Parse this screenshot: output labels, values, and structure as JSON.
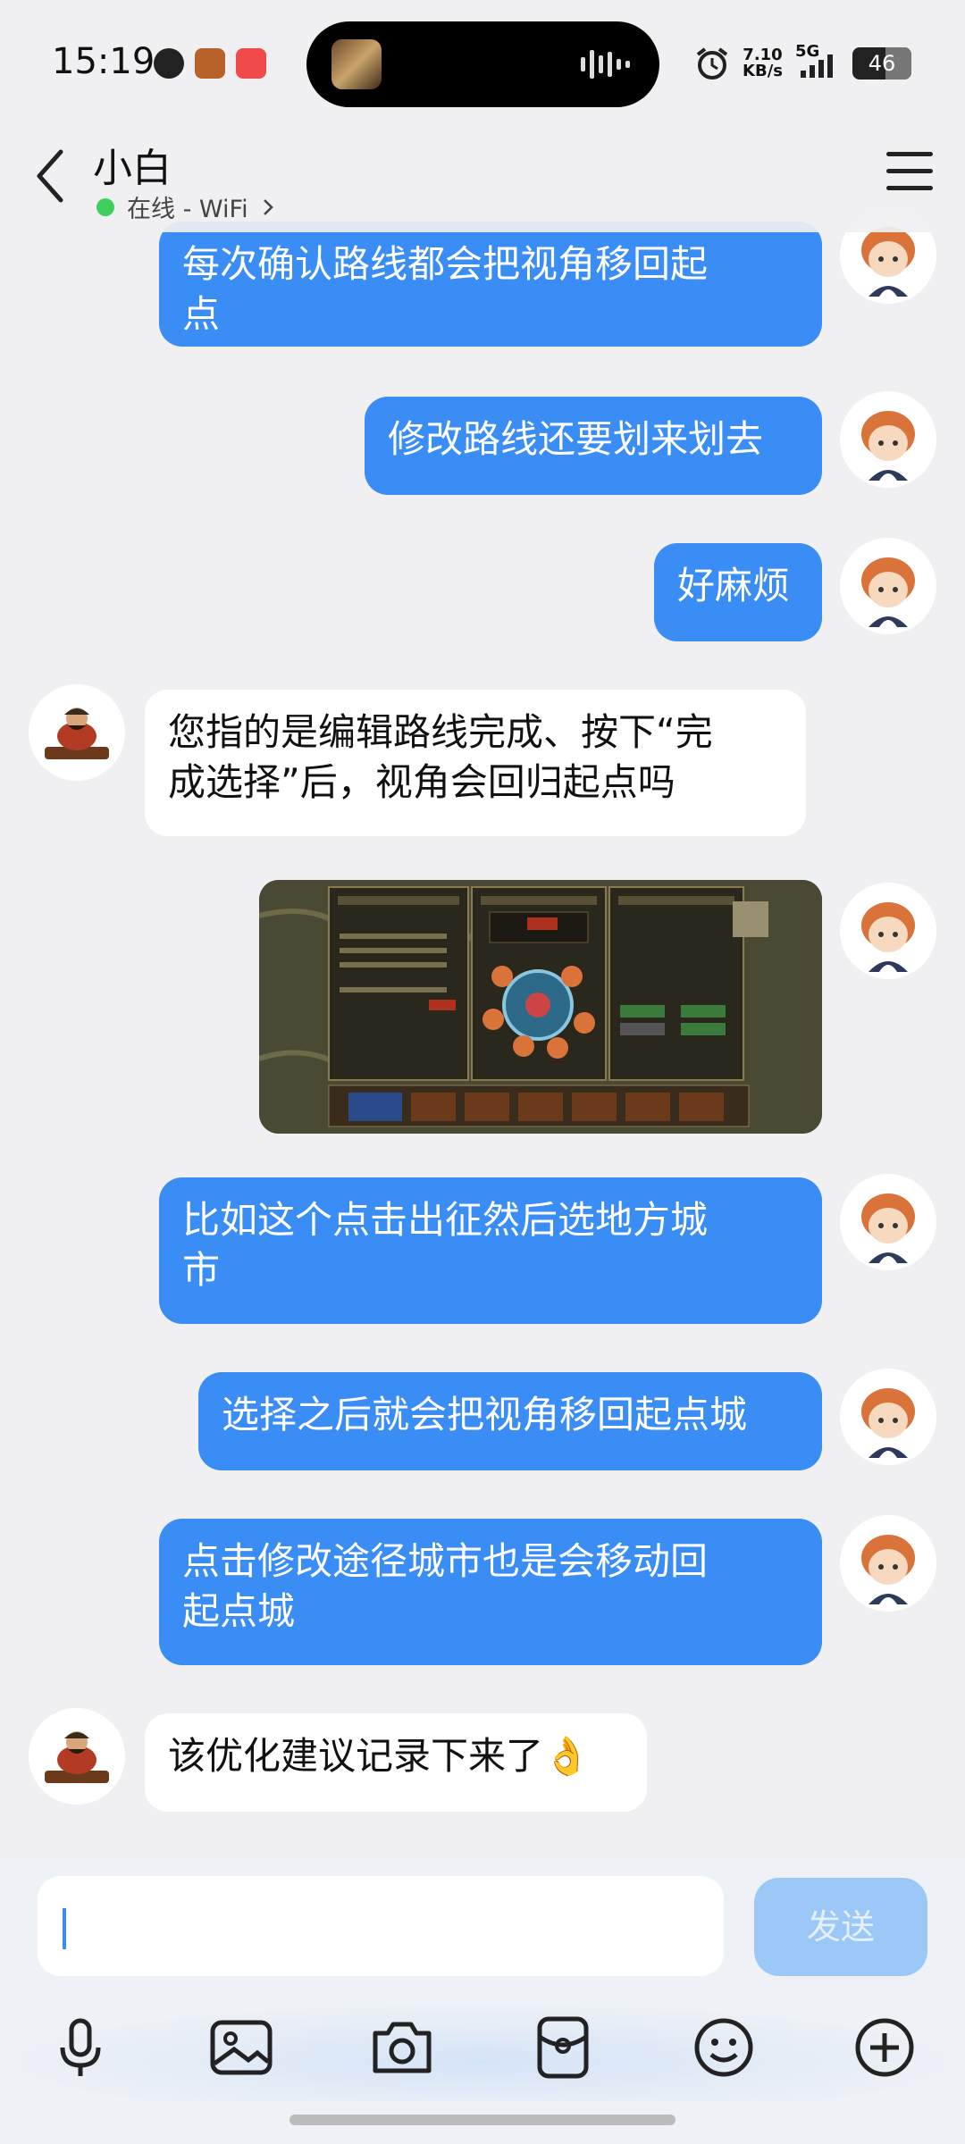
{
  "status_bar": {
    "time": "15:19",
    "net_speed": "7.10",
    "net_unit": "KB/s",
    "network": "5G",
    "battery": "46"
  },
  "header": {
    "contact_name": "小白",
    "online_status": "在线 - WiFi"
  },
  "messages": [
    {
      "side": "out",
      "text": "每次确认路线都会把视角移回起点"
    },
    {
      "side": "out",
      "text": "修改路线还要划来划去"
    },
    {
      "side": "out",
      "text": "好麻烦"
    },
    {
      "side": "in",
      "text": "您指的是编辑路线完成、按下“完成选择”后，视角会回归起点吗"
    },
    {
      "side": "out",
      "type": "image"
    },
    {
      "side": "out",
      "text": "比如这个点击出征然后选地方城市"
    },
    {
      "side": "out",
      "text": "选择之后就会把视角移回起点城"
    },
    {
      "side": "out",
      "text": "点击修改途径城市也是会移动回起点城"
    },
    {
      "side": "in",
      "text": "该优化建议记录下来了👌"
    }
  ],
  "msg_lines": {
    "m0": [
      "每次确认路线都会把视角移回起",
      "点"
    ],
    "m3": [
      "您指的是编辑路线完成、按下“完",
      "成选择”后，视角会回归起点吗"
    ],
    "m5": [
      "比如这个点击出征然后选地方城",
      "市"
    ],
    "m7": [
      "点击修改途径城市也是会移动回",
      "起点城"
    ]
  },
  "composer": {
    "send_label": "发送",
    "input_value": ""
  },
  "toolbar_icons": [
    "microphone-icon",
    "image-icon",
    "camera-icon",
    "red-packet-icon",
    "emoji-icon",
    "plus-icon"
  ],
  "colors": {
    "outgoing_bubble": "#3a8df5",
    "incoming_bubble": "#ffffff",
    "background": "#f0f0f2",
    "send_disabled": "#9cc8f7",
    "online_dot": "#3ccf5c"
  }
}
